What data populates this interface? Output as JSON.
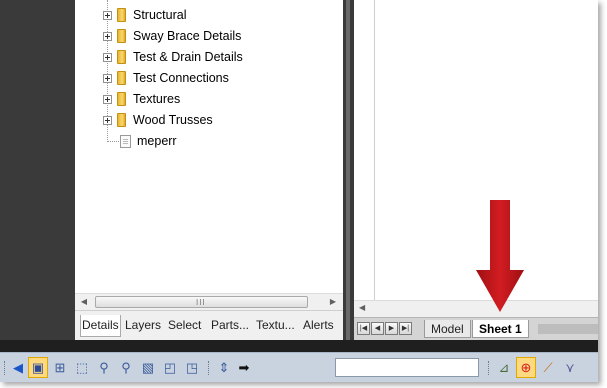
{
  "tree": {
    "items": [
      {
        "label": "Structural",
        "icon": "folder-icon",
        "expandable": true
      },
      {
        "label": "Sway Brace Details",
        "icon": "folder-icon",
        "expandable": true
      },
      {
        "label": "Test & Drain Details",
        "icon": "folder-icon",
        "expandable": true
      },
      {
        "label": "Test Connections",
        "icon": "folder-icon",
        "expandable": true
      },
      {
        "label": "Textures",
        "icon": "folder-icon",
        "expandable": true
      },
      {
        "label": "Wood Trusses",
        "icon": "folder-icon",
        "expandable": true
      },
      {
        "label": "meperr",
        "icon": "file-icon",
        "expandable": false
      }
    ],
    "scroll_grip": "III"
  },
  "panel_tabs": [
    "Details",
    "Layers",
    "Select",
    "Parts...",
    "Textu...",
    "Alerts"
  ],
  "panel_active_tab": "Details",
  "layout_tabs": [
    "Model",
    "Sheet 1"
  ],
  "layout_active_tab": "Sheet 1",
  "annotation": {
    "arrow_color": "#c0161a"
  },
  "toolbar": {
    "icons": [
      "eye-icon",
      "window-icon",
      "zoom-extents-icon",
      "zoom-window-icon",
      "zoom-in-icon",
      "zoom-out-icon",
      "zoom-selection-icon",
      "previous-view-icon",
      "next-view-icon",
      "pan-icon",
      "arrow-right-icon",
      "snap-perpendicular-icon",
      "snap-center-icon",
      "snap-endpoint-icon",
      "snap-tangent-icon"
    ],
    "command_input": ""
  },
  "colors": {
    "accent": "#ffd980",
    "arrow": "#c0161a",
    "toolbar_bg": "#c9d3e0"
  }
}
